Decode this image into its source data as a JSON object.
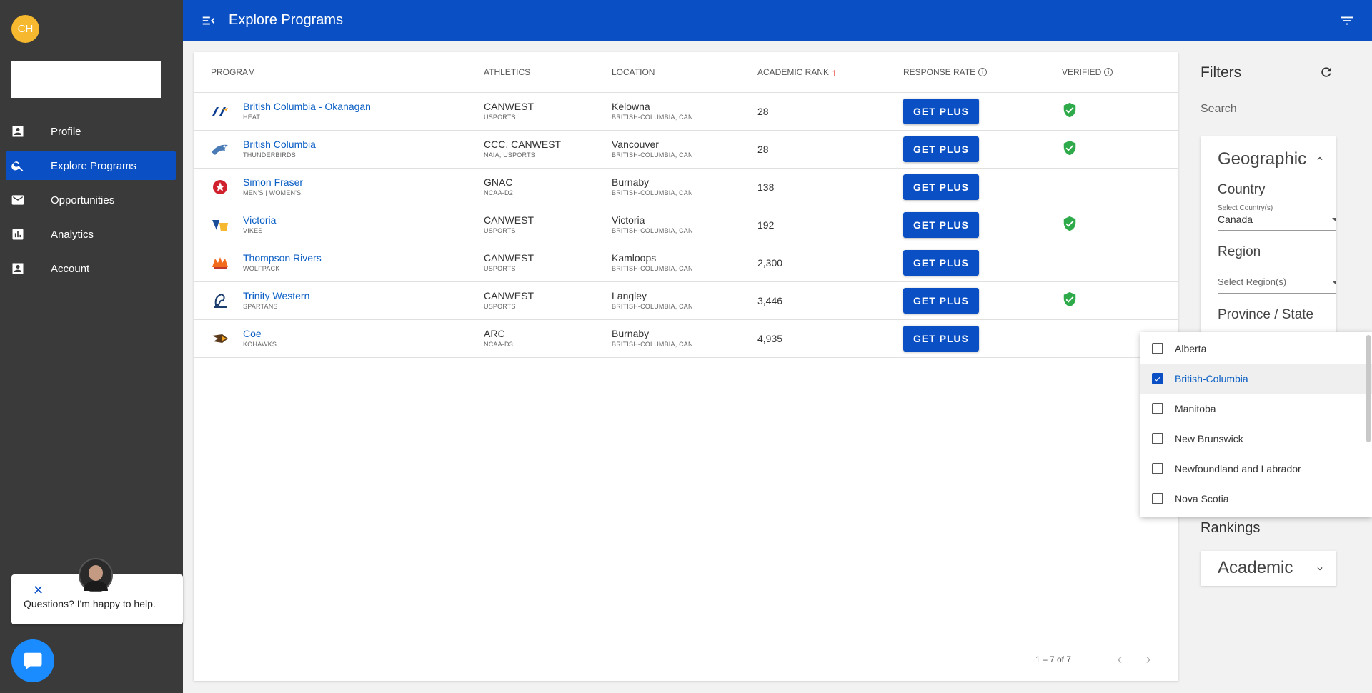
{
  "user": {
    "initials": "CH"
  },
  "sidebar": {
    "items": [
      {
        "label": "Profile",
        "icon": "profile-icon",
        "active": false
      },
      {
        "label": "Explore Programs",
        "icon": "search-icon",
        "active": true
      },
      {
        "label": "Opportunities",
        "icon": "mail-icon",
        "active": false
      },
      {
        "label": "Analytics",
        "icon": "analytics-icon",
        "active": false
      },
      {
        "label": "Account",
        "icon": "account-icon",
        "active": false
      }
    ]
  },
  "chat": {
    "message": "Questions? I'm happy to help."
  },
  "header": {
    "title": "Explore Programs"
  },
  "table": {
    "columns": [
      "PROGRAM",
      "ATHLETICS",
      "LOCATION",
      "ACADEMIC RANK",
      "RESPONSE RATE",
      "VERIFIED"
    ],
    "button_label": "GET PLUS",
    "rows": [
      {
        "name": "British Columbia - Okanagan",
        "team": "HEAT",
        "athletics": "CANWEST",
        "athletics_sub": "USPORTS",
        "city": "Kelowna",
        "region": "BRITISH-COLUMBIA, CAN",
        "rank": "28",
        "verified": true
      },
      {
        "name": "British Columbia",
        "team": "THUNDERBIRDS",
        "athletics": "CCC, CANWEST",
        "athletics_sub": "NAIA, USPORTS",
        "city": "Vancouver",
        "region": "BRITISH-COLUMBIA, CAN",
        "rank": "28",
        "verified": true
      },
      {
        "name": "Simon Fraser",
        "team": "MEN'S | WOMEN'S",
        "athletics": "GNAC",
        "athletics_sub": "NCAA-D2",
        "city": "Burnaby",
        "region": "BRITISH-COLUMBIA, CAN",
        "rank": "138",
        "verified": false
      },
      {
        "name": "Victoria",
        "team": "VIKES",
        "athletics": "CANWEST",
        "athletics_sub": "USPORTS",
        "city": "Victoria",
        "region": "BRITISH-COLUMBIA, CAN",
        "rank": "192",
        "verified": true
      },
      {
        "name": "Thompson Rivers",
        "team": "WOLFPACK",
        "athletics": "CANWEST",
        "athletics_sub": "USPORTS",
        "city": "Kamloops",
        "region": "BRITISH-COLUMBIA, CAN",
        "rank": "2,300",
        "verified": false
      },
      {
        "name": "Trinity Western",
        "team": "SPARTANS",
        "athletics": "CANWEST",
        "athletics_sub": "USPORTS",
        "city": "Langley",
        "region": "BRITISH-COLUMBIA, CAN",
        "rank": "3,446",
        "verified": true
      },
      {
        "name": "Coe",
        "team": "KOHAWKS",
        "athletics": "ARC",
        "athletics_sub": "NCAA-D3",
        "city": "Burnaby",
        "region": "BRITISH-COLUMBIA, CAN",
        "rank": "4,935",
        "verified": false
      }
    ],
    "pagination": "1 – 7 of 7"
  },
  "filters": {
    "title": "Filters",
    "search_placeholder": "Search",
    "geographic": {
      "title": "Geographic",
      "country_label": "Country",
      "country_caption": "Select Country(s)",
      "country_value": "Canada",
      "region_label": "Region",
      "region_placeholder": "Select Region(s)",
      "province_label": "Province / State"
    },
    "rankings_title": "Rankings",
    "academic_title": "Academic"
  },
  "province_dropdown": {
    "options": [
      {
        "label": "Alberta",
        "checked": false
      },
      {
        "label": "British-Columbia",
        "checked": true
      },
      {
        "label": "Manitoba",
        "checked": false
      },
      {
        "label": "New Brunswick",
        "checked": false
      },
      {
        "label": "Newfoundland and Labrador",
        "checked": false
      },
      {
        "label": "Nova Scotia",
        "checked": false
      }
    ]
  },
  "colors": {
    "primary": "#0a50c4",
    "sidebar": "#3a3a3a",
    "verified": "#2eaa4a",
    "avatar": "#f5b82e"
  }
}
